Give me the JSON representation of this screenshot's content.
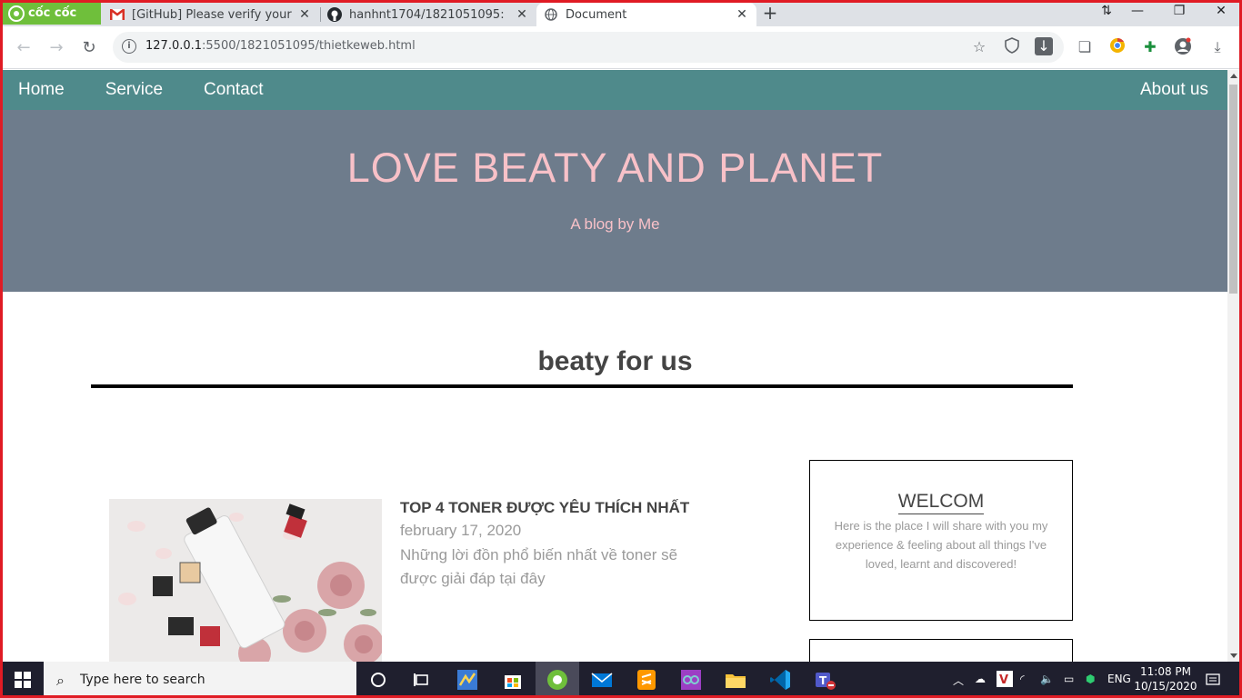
{
  "browser": {
    "brand": "cốc cốc",
    "tabs": [
      {
        "title": "[GitHub] Please verify your de",
        "close": "✕"
      },
      {
        "title": "hanhnt1704/1821051095: 182",
        "close": "✕"
      },
      {
        "title": "Document",
        "close": "✕"
      }
    ],
    "url_host": "127.0.0.1",
    "url_rest": ":5500/1821051095/thietkeweb.html"
  },
  "site": {
    "nav": {
      "home": "Home",
      "service": "Service",
      "contact": "Contact",
      "about": "About us"
    },
    "hero": {
      "title": "LOVE BEATY AND PLANET",
      "subtitle": "A blog by Me"
    },
    "section_title": "beaty for us",
    "post": {
      "title": "TOP 4 TONER ĐƯỢC YÊU THÍCH NHẤT",
      "date": "february 17, 2020",
      "excerpt": "Những lời đồn phổ biến nhất về toner sẽ được giải đáp tại đây"
    },
    "widget": {
      "title": "WELCOM",
      "text": "Here is the place I will share with you my experience & feeling about all things I've loved, learnt and discovered!"
    }
  },
  "taskbar": {
    "search_placeholder": "Type here to search",
    "lang": "ENG",
    "time": "11:08 PM",
    "date": "10/15/2020"
  }
}
